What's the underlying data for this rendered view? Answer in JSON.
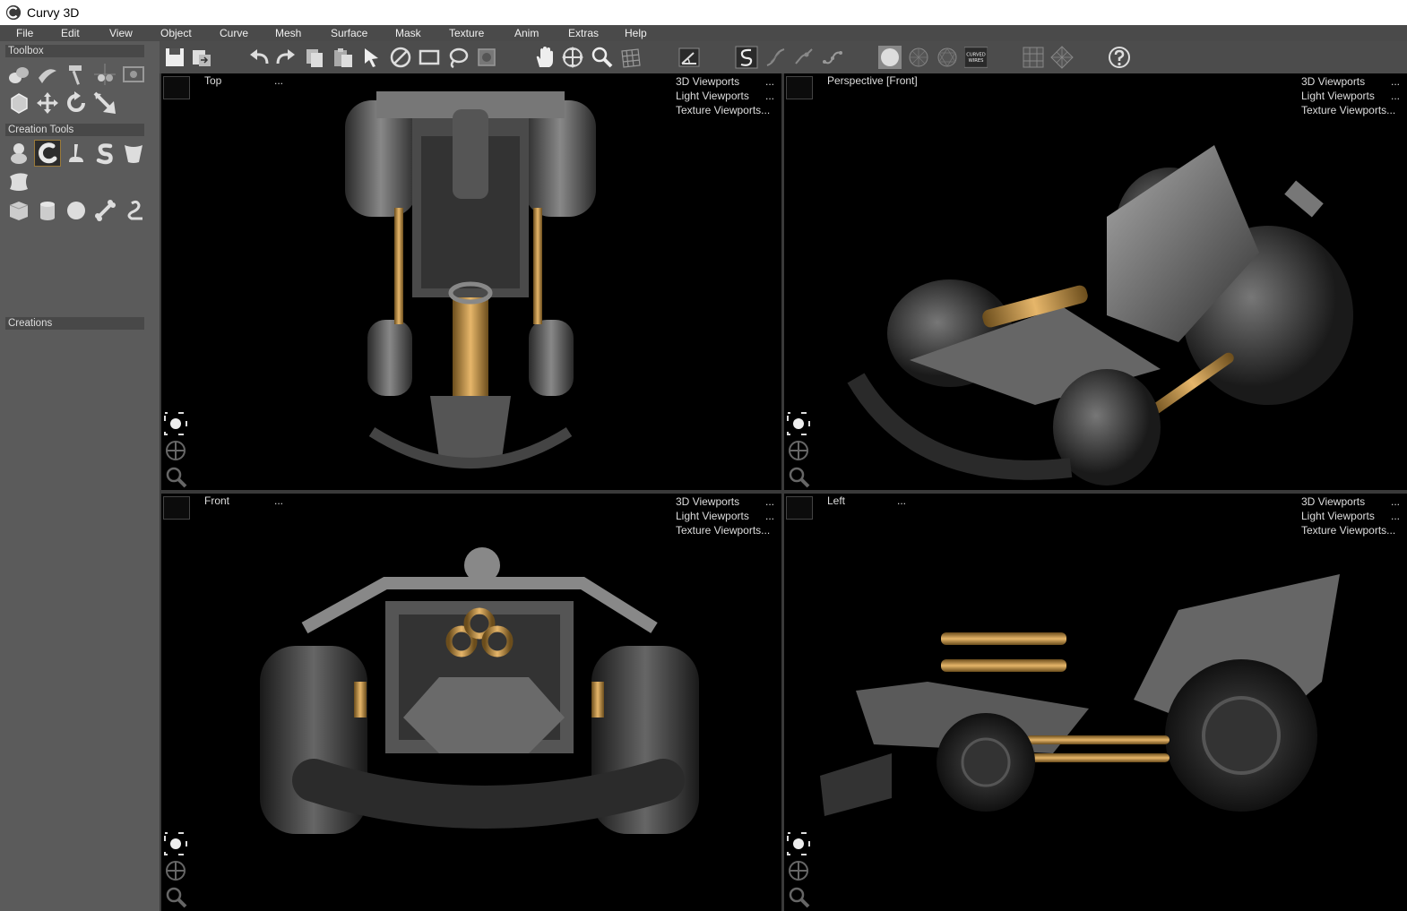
{
  "app": {
    "title": "Curvy 3D"
  },
  "menu": [
    "File",
    "Edit",
    "View",
    "Object",
    "Curve",
    "Mesh",
    "Surface",
    "Mask",
    "Texture",
    "Anim",
    "Extras",
    "Help"
  ],
  "sidebar": {
    "toolbox_label": "Toolbox",
    "creation_tools_label": "Creation Tools",
    "creations_label": "Creations"
  },
  "toolbar": {
    "curved_wires_label": "CURVED\nWIRES"
  },
  "viewport_menu": {
    "item1": "3D Viewports",
    "item2": "Light Viewports",
    "item3": "Texture Viewports...",
    "more": "..."
  },
  "viewports": [
    {
      "name": "Top",
      "more": "..."
    },
    {
      "name": "Perspective [Front]",
      "more": ""
    },
    {
      "name": "Front",
      "more": "..."
    },
    {
      "name": "Left",
      "more": "..."
    }
  ],
  "colors": {
    "accent": "#c89a4a",
    "panel": "#5b5b5b",
    "viewport_bg": "#000000"
  }
}
